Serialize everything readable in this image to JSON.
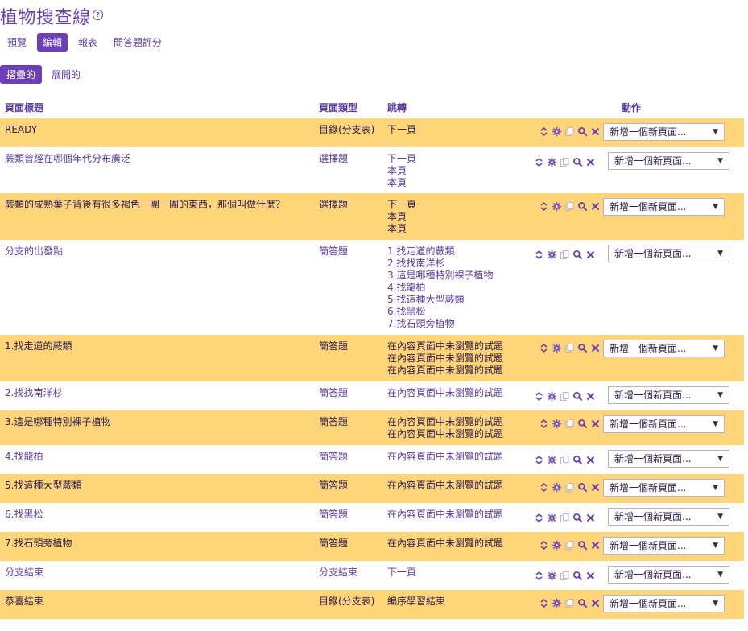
{
  "page": {
    "title": "植物搜查線",
    "help": "?"
  },
  "tabs": [
    {
      "label": "預覽",
      "active": false
    },
    {
      "label": "編輯",
      "active": true
    },
    {
      "label": "報表",
      "active": false
    },
    {
      "label": "問答題評分",
      "active": false
    }
  ],
  "subtabs": [
    {
      "label": "摺疊的",
      "active": true
    },
    {
      "label": "展開的",
      "active": false
    }
  ],
  "headers": {
    "title": "頁面標題",
    "type": "頁面類型",
    "jump": "跳轉",
    "actions": "動作"
  },
  "add_page_label": "新增一個新頁面...",
  "colors": {
    "accent": "#6e3fb4",
    "highlight": "#ffd57a",
    "text": "#5a3a9a"
  },
  "rows": [
    {
      "title": "READY",
      "type": "目錄(分支表)",
      "jumps": [
        "下一頁"
      ],
      "highlight": true
    },
    {
      "title": "蕨類曾經在哪個年代分布廣泛",
      "type": "選擇題",
      "jumps": [
        "下一頁",
        "本頁",
        "本頁"
      ],
      "highlight": false
    },
    {
      "title": "蕨類的成熟葉子背後有很多褐色一團一團的東西，那個叫做什麼？",
      "type": "選擇題",
      "jumps": [
        "下一頁",
        "本頁",
        "本頁"
      ],
      "highlight": true
    },
    {
      "title": "分支的出發點",
      "type": "簡答題",
      "jumps": [
        "1.找走道的蕨類",
        "2.找找南洋杉",
        "3.這是哪種特別裸子植物",
        "4.找龍柏",
        "5.找這種大型蕨類",
        "6.找黑松",
        "7.找石頭旁植物"
      ],
      "highlight": false
    },
    {
      "title": "1.找走道的蕨類",
      "type": "簡答題",
      "jumps": [
        "在內容頁面中未瀏覽的試題",
        "在內容頁面中未瀏覽的試題",
        "在內容頁面中未瀏覽的試題"
      ],
      "highlight": true
    },
    {
      "title": "2.找找南洋杉",
      "type": "簡答題",
      "jumps": [
        "在內容頁面中未瀏覽的試題"
      ],
      "highlight": false
    },
    {
      "title": "3.這是哪種特別裸子植物",
      "type": "簡答題",
      "jumps": [
        "在內容頁面中未瀏覽的試題",
        "在內容頁面中未瀏覽的試題"
      ],
      "highlight": true
    },
    {
      "title": "4.找龍柏",
      "type": "簡答題",
      "jumps": [
        "在內容頁面中未瀏覽的試題"
      ],
      "highlight": false
    },
    {
      "title": "5.找這種大型蕨類",
      "type": "簡答題",
      "jumps": [
        "在內容頁面中未瀏覽的試題"
      ],
      "highlight": true
    },
    {
      "title": "6.找黑松",
      "type": "簡答題",
      "jumps": [
        "在內容頁面中未瀏覽的試題"
      ],
      "highlight": false
    },
    {
      "title": "7.找石頭旁植物",
      "type": "簡答題",
      "jumps": [
        "在內容頁面中未瀏覽的試題"
      ],
      "highlight": true
    },
    {
      "title": "分支結束",
      "type": "分支結束",
      "jumps": [
        "下一頁"
      ],
      "highlight": false
    },
    {
      "title": "恭喜結束",
      "type": "目錄(分支表)",
      "jumps": [
        "編序學習結束"
      ],
      "highlight": true
    }
  ]
}
